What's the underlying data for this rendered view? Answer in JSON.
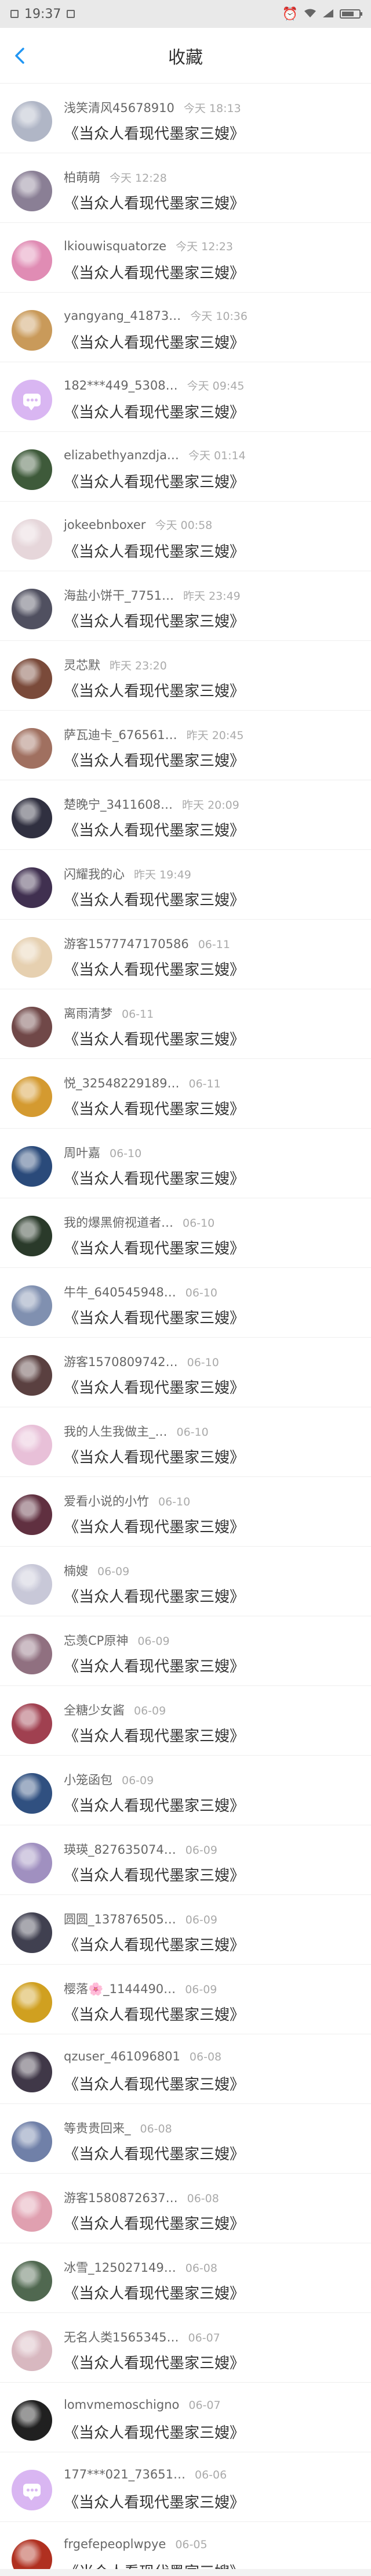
{
  "status_bar": {
    "time": "19:37"
  },
  "header": {
    "title": "收藏"
  },
  "colors": {
    "accent": "#2196f3",
    "default_avatar": "#d9b6f2"
  },
  "items": [
    {
      "user": "浅笑清风45678910",
      "time": "今天 18:13",
      "book": "《当众人看现代墨家三嫂》",
      "avatar": "#b0b6c6"
    },
    {
      "user": "柏萌萌",
      "time": "今天 12:28",
      "book": "《当众人看现代墨家三嫂》",
      "avatar": "#8a7f95"
    },
    {
      "user": "lkiouwisquatorze",
      "time": "今天 12:23",
      "book": "《当众人看现代墨家三嫂》",
      "avatar": "#e08cb4"
    },
    {
      "user": "yangyang_41873…",
      "time": "今天 10:36",
      "book": "《当众人看现代墨家三嫂》",
      "avatar": "#c99a5a"
    },
    {
      "user": "182***449_5308…",
      "time": "今天 09:45",
      "book": "《当众人看现代墨家三嫂》",
      "avatar": "",
      "icon": "chat-bubble-icon"
    },
    {
      "user": "elizabethyanzdja…",
      "time": "今天 01:14",
      "book": "《当众人看现代墨家三嫂》",
      "avatar": "#3e5a3a"
    },
    {
      "user": "jokeebnboxer",
      "time": "今天 00:58",
      "book": "《当众人看现代墨家三嫂》",
      "avatar": "#e6d6da"
    },
    {
      "user": "海盐小饼干_7751…",
      "time": "昨天 23:49",
      "book": "《当众人看现代墨家三嫂》",
      "avatar": "#505060"
    },
    {
      "user": "灵芯默",
      "time": "昨天 23:20",
      "book": "《当众人看现代墨家三嫂》",
      "avatar": "#7a4a3a"
    },
    {
      "user": "萨瓦迪卡_676561…",
      "time": "昨天 20:45",
      "book": "《当众人看现代墨家三嫂》",
      "avatar": "#a07060"
    },
    {
      "user": "楚晚宁_3411608…",
      "time": "昨天 20:09",
      "book": "《当众人看现代墨家三嫂》",
      "avatar": "#303040"
    },
    {
      "user": "闪耀我的心",
      "time": "昨天 19:49",
      "book": "《当众人看现代墨家三嫂》",
      "avatar": "#403050"
    },
    {
      "user": "游客1577747170586",
      "time": "06-11",
      "book": "《当众人看现代墨家三嫂》",
      "avatar": "#e6d0b0"
    },
    {
      "user": "离雨清梦",
      "time": "06-11",
      "book": "《当众人看现代墨家三嫂》",
      "avatar": "#704848"
    },
    {
      "user": "悦_32548229189…",
      "time": "06-11",
      "book": "《当众人看现代墨家三嫂》",
      "avatar": "#d49a30"
    },
    {
      "user": "周叶嘉",
      "time": "06-10",
      "book": "《当众人看现代墨家三嫂》",
      "avatar": "#2a4a7a"
    },
    {
      "user": "我的爆黑俯视道者…",
      "time": "06-10",
      "book": "《当众人看现代墨家三嫂》",
      "avatar": "#2a3a2a"
    },
    {
      "user": "牛牛_640545948…",
      "time": "06-10",
      "book": "《当众人看现代墨家三嫂》",
      "avatar": "#8090b0"
    },
    {
      "user": "游客1570809742…",
      "time": "06-10",
      "book": "《当众人看现代墨家三嫂》",
      "avatar": "#5a4040"
    },
    {
      "user": "我的人生我做主_…",
      "time": "06-10",
      "book": "《当众人看现代墨家三嫂》",
      "avatar": "#e8c0d8"
    },
    {
      "user": "爱看小说的小竹",
      "time": "06-10",
      "book": "《当众人看现代墨家三嫂》",
      "avatar": "#603040"
    },
    {
      "user": "楠嫂",
      "time": "06-09",
      "book": "《当众人看现代墨家三嫂》",
      "avatar": "#c8c8d8"
    },
    {
      "user": "忘羡CP原神",
      "time": "06-09",
      "book": "《当众人看现代墨家三嫂》",
      "avatar": "#907080"
    },
    {
      "user": "全糖少女酱",
      "time": "06-09",
      "book": "《当众人看现代墨家三嫂》",
      "avatar": "#a04050"
    },
    {
      "user": "小笼函包",
      "time": "06-09",
      "book": "《当众人看现代墨家三嫂》",
      "avatar": "#305080"
    },
    {
      "user": "瑛瑛_827635074…",
      "time": "06-09",
      "book": "《当众人看现代墨家三嫂》",
      "avatar": "#a090c0"
    },
    {
      "user": "圆圆_137876505…",
      "time": "06-09",
      "book": "《当众人看现代墨家三嫂》",
      "avatar": "#404050"
    },
    {
      "user": "樱落🌸_1144490…",
      "time": "06-09",
      "book": "《当众人看现代墨家三嫂》",
      "avatar": "#d0a020"
    },
    {
      "user": "qzuser_461096801",
      "time": "06-08",
      "book": "《当众人看现代墨家三嫂》",
      "avatar": "#403848"
    },
    {
      "user": "等贵贵回来_",
      "time": "06-08",
      "book": "《当众人看现代墨家三嫂》",
      "avatar": "#7080a8"
    },
    {
      "user": "游客1580872637…",
      "time": "06-08",
      "book": "《当众人看现代墨家三嫂》",
      "avatar": "#e0a0b0"
    },
    {
      "user": "冰雪_125027149…",
      "time": "06-08",
      "book": "《当众人看现代墨家三嫂》",
      "avatar": "#506850"
    },
    {
      "user": "无名人类1565345…",
      "time": "06-07",
      "book": "《当众人看现代墨家三嫂》",
      "avatar": "#d8b8c0"
    },
    {
      "user": "lomvmemoschigno",
      "time": "06-07",
      "book": "《当众人看现代墨家三嫂》",
      "avatar": "#202020"
    },
    {
      "user": "177***021_73651…",
      "time": "06-06",
      "book": "《当众人看现代墨家三嫂》",
      "avatar": "",
      "icon": "chat-bubble-icon"
    },
    {
      "user": "frgefepeoplwpye",
      "time": "06-05",
      "book": "《当众人看现代墨家三嫂》",
      "avatar": "#b03020"
    }
  ]
}
